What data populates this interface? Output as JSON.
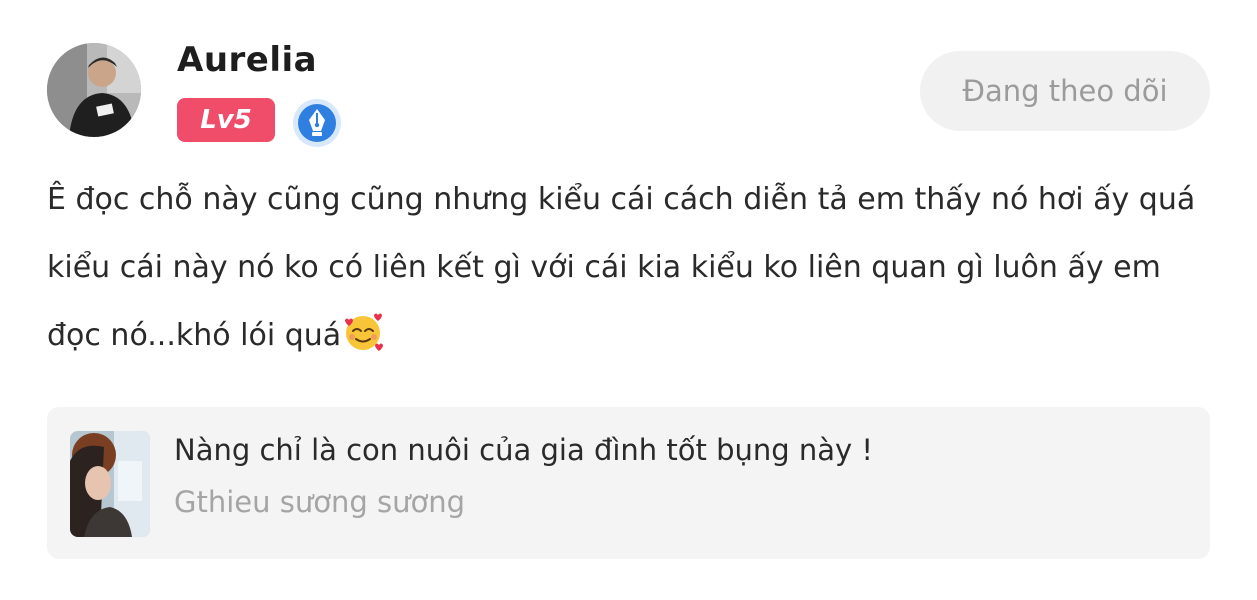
{
  "post": {
    "author": {
      "name": "Aurelia",
      "level": "Lv5",
      "avatar": "user-avatar-photo",
      "badge_icon": "quill-pen-badge-icon"
    },
    "follow_button_label": "Đang theo dõi",
    "comment_text": "Ê đọc chỗ này cũng cũng nhưng kiểu cái cách diễn tả em thấy nó hơi ấy quá kiểu cái này nó ko có liên kết gì với cái kia kiểu ko liên quan gì luôn ấy em đọc nó...khó lói quá",
    "comment_emoji": "smiling-face-with-hearts-emoji",
    "reference": {
      "title": "Nàng chỉ là con nuôi của gia đình tốt bụng này !",
      "author": "Gthieu sương sương",
      "cover": "story-cover-thumbnail"
    }
  },
  "colors": {
    "level_badge": "#ef4d6a",
    "follow_button_bg": "#f1f1f1",
    "follow_button_text": "#9b9b9b",
    "reference_bg": "#f4f4f4",
    "muted_text": "#a5a5a5",
    "badge_blue": "#2f7fe0"
  }
}
